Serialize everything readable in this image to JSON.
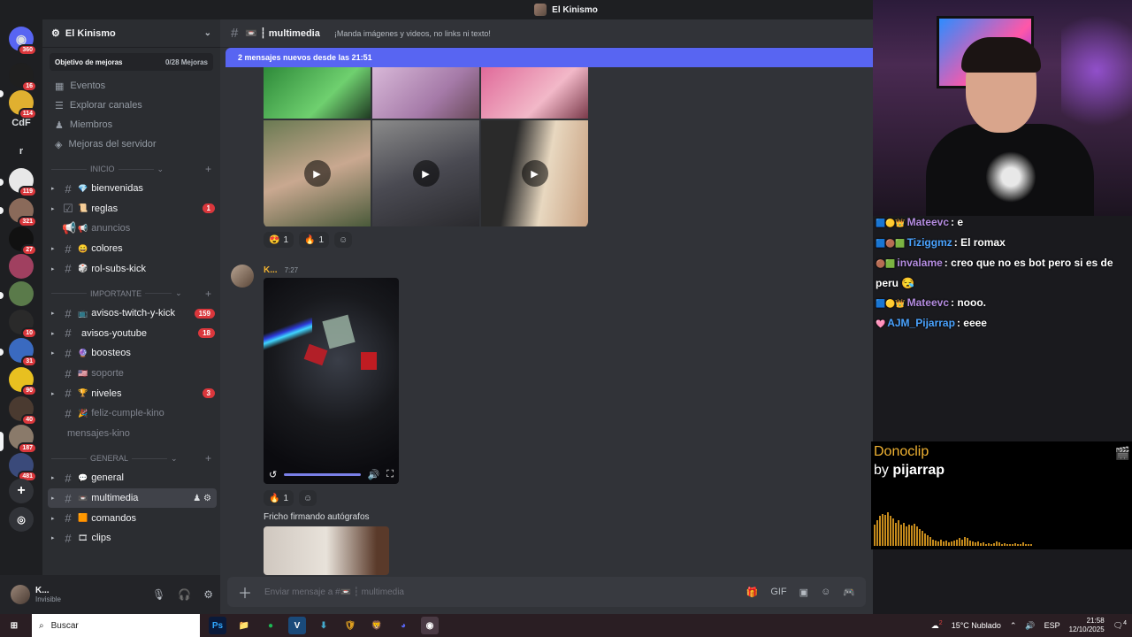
{
  "window": {
    "title": "El Kinismo"
  },
  "rail": {
    "items": [
      {
        "label": "",
        "badge": "360"
      },
      {
        "label": "",
        "badge": "16"
      },
      {
        "label": "",
        "badge": "114"
      },
      {
        "label": "CdF",
        "badge": ""
      },
      {
        "label": "r",
        "badge": ""
      },
      {
        "label": "",
        "badge": "119"
      },
      {
        "label": "",
        "badge": "321"
      },
      {
        "label": "",
        "badge": "27"
      },
      {
        "label": "",
        "badge": ""
      },
      {
        "label": "",
        "badge": ""
      },
      {
        "label": "",
        "badge": "10"
      },
      {
        "label": "",
        "badge": "31"
      },
      {
        "label": "",
        "badge": "90"
      },
      {
        "label": "",
        "badge": "40"
      },
      {
        "label": "",
        "badge": "187"
      },
      {
        "label": "",
        "badge": "481"
      }
    ]
  },
  "server": {
    "name": "El Kinismo",
    "boost_label": "Objetivo de mejoras",
    "boost_progress": "0/28 Mejoras",
    "nav": [
      "Eventos",
      "Explorar canales",
      "Miembros",
      "Mejoras del servidor"
    ]
  },
  "categories": {
    "inicio": "INICIO",
    "importante": "IMPORTANTE",
    "general": "GENERAL"
  },
  "channels": {
    "inicio": [
      {
        "name": "bienvenidas",
        "emoji": "💎",
        "count": ""
      },
      {
        "name": "reglas",
        "emoji": "📜",
        "count": "1"
      },
      {
        "name": "anuncios",
        "emoji": "📢",
        "count": ""
      },
      {
        "name": "colores",
        "emoji": "😀",
        "count": ""
      },
      {
        "name": "rol-subs-kick",
        "emoji": "🎲",
        "count": ""
      }
    ],
    "importante": [
      {
        "name": "avisos-twitch-y-kick",
        "emoji": "📺",
        "count": "159"
      },
      {
        "name": "avisos-youtube",
        "emoji": "",
        "count": "18"
      },
      {
        "name": "boosteos",
        "emoji": "🔮",
        "count": ""
      },
      {
        "name": "soporte",
        "emoji": "🇺🇸",
        "count": ""
      },
      {
        "name": "niveles",
        "emoji": "🏆",
        "count": "3"
      },
      {
        "name": "feliz-cumple-kino",
        "emoji": "🎉",
        "count": ""
      },
      {
        "name": "mensajes-kino",
        "emoji": "",
        "count": ""
      }
    ],
    "general": [
      {
        "name": "general",
        "emoji": "💬",
        "count": ""
      },
      {
        "name": "multimedia",
        "emoji": "📼",
        "count": ""
      },
      {
        "name": "comandos",
        "emoji": "🟧",
        "count": ""
      },
      {
        "name": "clips",
        "emoji": "🎞",
        "count": ""
      }
    ]
  },
  "user": {
    "name": "K...",
    "status": "Invisible"
  },
  "main": {
    "channel_name": "📼 ┆ multimedia",
    "topic": "¡Manda imágenes y videos, no links ni texto!",
    "new_messages": "2 mensajes nuevos desde las 21:51",
    "reactions1": [
      {
        "emoji": "😍",
        "count": "1"
      },
      {
        "emoji": "🔥",
        "count": "1"
      }
    ],
    "author": "K...",
    "time": "7:27",
    "reactions2": [
      {
        "emoji": "🔥",
        "count": "1"
      }
    ],
    "caption": "Fricho firmando autógrafos",
    "composer_placeholder": "Enviar mensaje a #📼 ┆ multimedia"
  },
  "stream_chat": [
    {
      "user": "Mateevc",
      "msg": "e",
      "color": "#b48ce0"
    },
    {
      "user": "Tiziggmz",
      "msg": "El romax",
      "color": "#4aa3ff"
    },
    {
      "user": "invalame",
      "msg": "creo que no es bot pero si es de peru 😪",
      "color": "#b48ce0"
    },
    {
      "user": "Mateevc",
      "msg": "nooo.",
      "color": "#b48ce0"
    },
    {
      "user": "AJM_Pijarrap",
      "msg": "eeee",
      "color": "#4aa3ff"
    }
  ],
  "donoclip": {
    "title": "Donoclip",
    "by": "by",
    "user": "pijarrap",
    "levels": [
      0.5,
      0.6,
      0.7,
      0.75,
      0.72,
      0.8,
      0.7,
      0.65,
      0.55,
      0.6,
      0.5,
      0.55,
      0.45,
      0.5,
      0.48,
      0.52,
      0.45,
      0.4,
      0.35,
      0.3,
      0.25,
      0.2,
      0.15,
      0.12,
      0.1,
      0.14,
      0.1,
      0.12,
      0.08,
      0.1,
      0.12,
      0.15,
      0.18,
      0.15,
      0.2,
      0.18,
      0.12,
      0.1,
      0.08,
      0.1,
      0.06,
      0.08,
      0.05,
      0.07,
      0.05,
      0.06,
      0.1,
      0.08,
      0.05,
      0.06,
      0.05,
      0.04,
      0.05,
      0.06,
      0.04,
      0.05,
      0.08,
      0.05,
      0.04,
      0.05
    ]
  },
  "taskbar": {
    "search": "Buscar",
    "weather": "15°C  Nublado",
    "lang": "ESP",
    "time": "21:58",
    "date": "12/10/2025",
    "notif": "4",
    "weather_badge": "2"
  }
}
